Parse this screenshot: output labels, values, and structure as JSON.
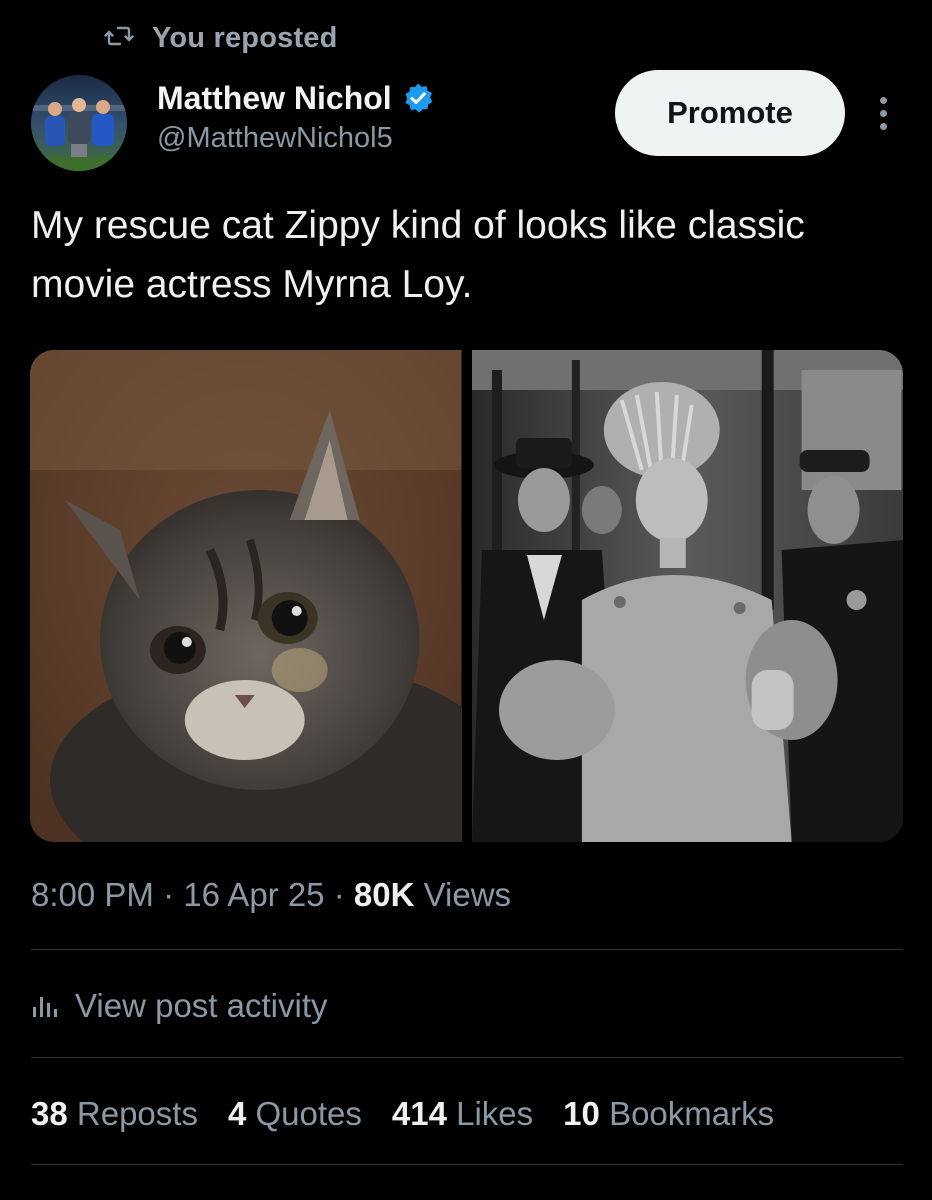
{
  "repost": {
    "label": "You reposted",
    "icon": "repost-icon"
  },
  "author": {
    "display_name": "Matthew Nichol",
    "handle": "@MatthewNichol5",
    "verified": true,
    "verified_color": "#1d9bf0"
  },
  "header": {
    "promote_label": "Promote",
    "more_icon": "more-options-icon"
  },
  "post": {
    "text": "My rescue cat Zippy kind of looks like classic movie actress Myrna Loy.",
    "media": [
      {
        "name": "cat-photo",
        "description_icon": "cat-photo"
      },
      {
        "name": "movie-still",
        "description_icon": "movie-still"
      }
    ]
  },
  "meta": {
    "time": "8:00 PM",
    "separator": "·",
    "date": "16 Apr 25",
    "views_count": "80K",
    "views_label": "Views"
  },
  "activity": {
    "label": "View post activity",
    "icon": "analytics-icon"
  },
  "stats": {
    "reposts_count": "38",
    "reposts_label": "Reposts",
    "quotes_count": "4",
    "quotes_label": "Quotes",
    "likes_count": "414",
    "likes_label": "Likes",
    "bookmarks_count": "10",
    "bookmarks_label": "Bookmarks"
  },
  "colors": {
    "background": "#000000",
    "primary_text": "#e7e9ea",
    "secondary_text": "#8b98a5",
    "divider": "#2f3336",
    "promote_bg": "#eff3f4"
  }
}
